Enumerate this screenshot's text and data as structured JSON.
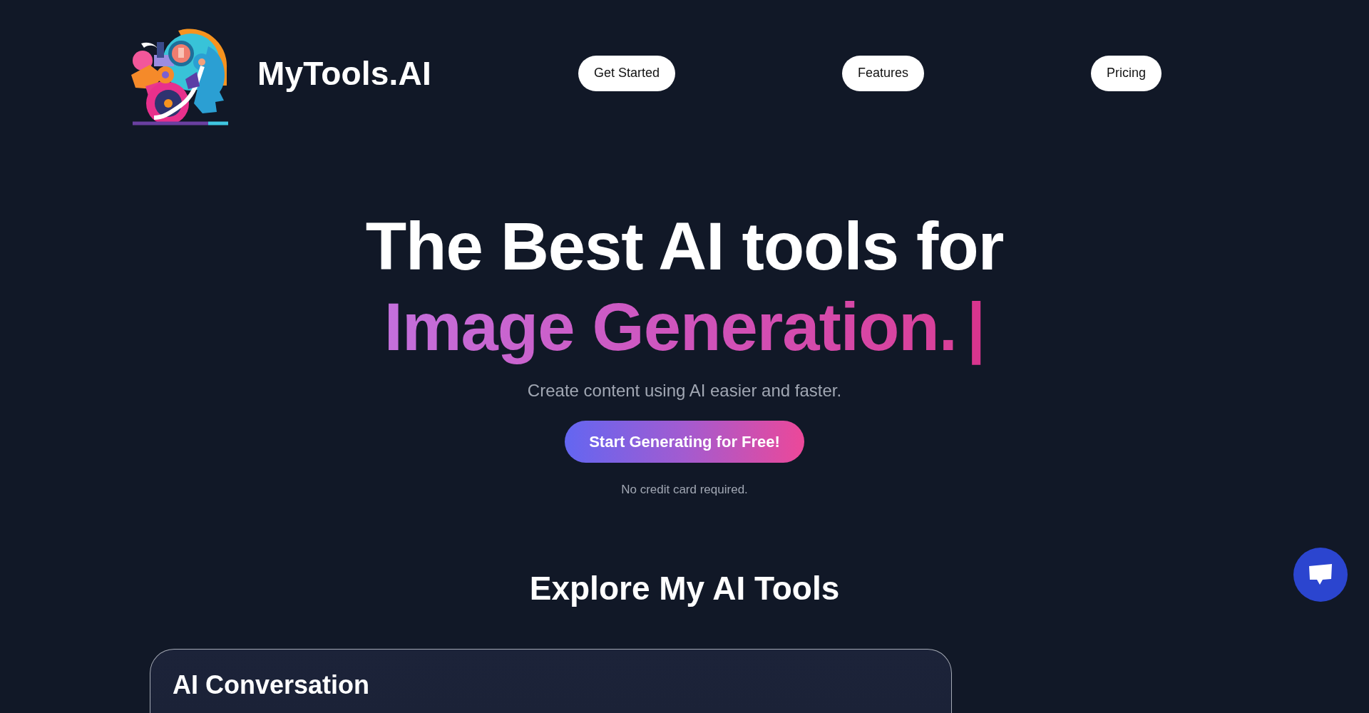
{
  "header": {
    "brand": "MyTools.AI",
    "nav": [
      "Get Started",
      "Features",
      "Pricing"
    ]
  },
  "hero": {
    "headline": "The Best AI tools for",
    "highlight": "Image Generation.",
    "typing_cursor": "|",
    "subtitle": "Create content using AI easier and faster.",
    "cta": "Start Generating for Free!",
    "note": "No credit card required."
  },
  "tools_section": {
    "title": "Explore My AI Tools",
    "cards": [
      {
        "title": "AI Conversation"
      }
    ]
  }
}
